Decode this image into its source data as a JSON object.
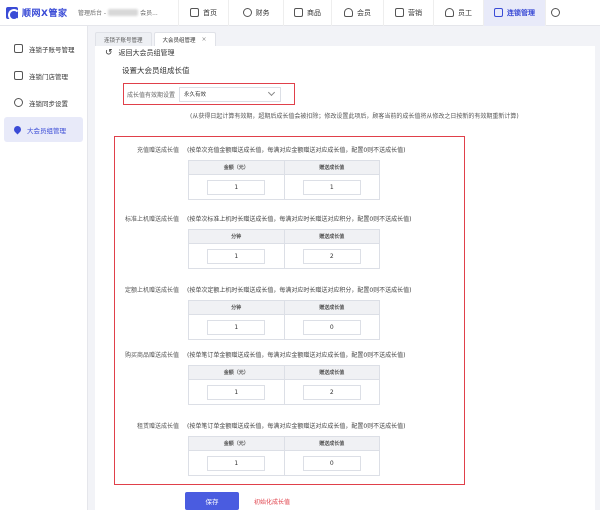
{
  "app": {
    "name": "顺网X管家"
  },
  "header": {
    "admin_prefix": "管理后台 -",
    "admin_suffix": "会员..."
  },
  "topnav": [
    {
      "label": "首页",
      "icon": "home-icon"
    },
    {
      "label": "财务",
      "icon": "finance-icon"
    },
    {
      "label": "商品",
      "icon": "goods-icon"
    },
    {
      "label": "会员",
      "icon": "member-icon"
    },
    {
      "label": "营销",
      "icon": "marketing-icon"
    },
    {
      "label": "员工",
      "icon": "staff-icon"
    },
    {
      "label": "连锁管理",
      "icon": "chain-icon",
      "active": true
    },
    {
      "label": "",
      "icon": "more-icon"
    }
  ],
  "sidebar": {
    "items": [
      {
        "label": "连锁子账号管理",
        "icon": "org-icon"
      },
      {
        "label": "连锁门店管理",
        "icon": "store-icon"
      },
      {
        "label": "连锁同步设置",
        "icon": "sync-icon"
      },
      {
        "label": "大会员组管理",
        "icon": "diamond-icon",
        "active": true
      }
    ]
  },
  "tabs": [
    {
      "label": "连锁子账号管理"
    },
    {
      "label": "大会员组管理",
      "close": "×",
      "active": true
    }
  ],
  "page": {
    "back_label": "返回大会员组管理",
    "title": "设置大会员组成长值",
    "validity_label": "成长值有效期设置",
    "validity_value": "永久有效",
    "validity_note": "(从获得日起计算有效期，超期后成长值会被扣除；修改设置此项后，顾客当前的成长值将从修改之日按新的有效期重新计算)"
  },
  "rules": [
    {
      "label": "充值赠送成长值",
      "desc": "(按单次充值金额赠送成长值，每满对应金额赠送对应成长值，配置0则不送成长值)",
      "col1": "金额（元）",
      "col2": "赠送成长值",
      "v1": "1",
      "v2": "1"
    },
    {
      "label": "标准上机赠送成长值",
      "desc": "(按单次标准上机时长赠送成长值，每满对应时长赠送对应积分，配置0则不送成长值)",
      "col1": "分钟",
      "col2": "赠送成长值",
      "v1": "1",
      "v2": "2"
    },
    {
      "label": "定额上机赠送成长值",
      "desc": "(按单次定额上机时长赠送成长值，每满对应时长赠送对应积分，配置0则不送成长值)",
      "col1": "分钟",
      "col2": "赠送成长值",
      "v1": "1",
      "v2": "0"
    },
    {
      "label": "购买商品赠送成长值",
      "desc": "(按单笔订单金额赠送成长值，每满对应金额赠送对应成长值，配置0则不送成长值)",
      "col1": "金额（元）",
      "col2": "赠送成长值",
      "v1": "1",
      "v2": "2"
    },
    {
      "label": "租赁赠送成长值",
      "desc": "(按单笔订单金额赠送成长值，每满对应金额赠送对应成长值，配置0则不送成长值)",
      "col1": "金额（元）",
      "col2": "赠送成长值",
      "v1": "1",
      "v2": "0"
    }
  ],
  "actions": {
    "save": "保存",
    "reset": "初始化成长值"
  },
  "colors": {
    "accent": "#3a4bd6",
    "highlight": "#e0404a",
    "button": "#4a5ce0"
  }
}
